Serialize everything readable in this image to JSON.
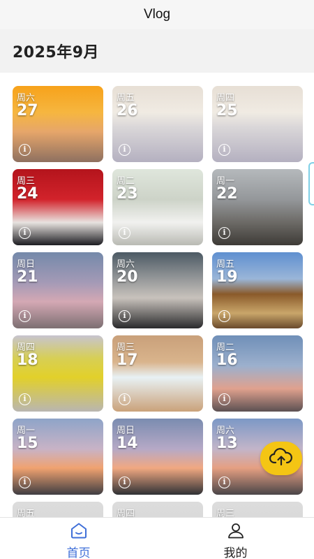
{
  "header": {
    "title": "Vlog"
  },
  "month_label": "2025年9月",
  "cards": [
    {
      "weekday": "周六",
      "day": "27",
      "bg": "sunset-sea"
    },
    {
      "weekday": "周五",
      "day": "26",
      "bg": "screen"
    },
    {
      "weekday": "周四",
      "day": "25",
      "bg": "screen"
    },
    {
      "weekday": "周三",
      "day": "24",
      "bg": "wedding"
    },
    {
      "weekday": "周二",
      "day": "23",
      "bg": "food"
    },
    {
      "weekday": "周一",
      "day": "22",
      "bg": "bus"
    },
    {
      "weekday": "周日",
      "day": "21",
      "bg": "sky-purple"
    },
    {
      "weekday": "周六",
      "day": "20",
      "bg": "metro"
    },
    {
      "weekday": "周五",
      "day": "19",
      "bg": "street"
    },
    {
      "weekday": "周四",
      "day": "18",
      "bg": "mango"
    },
    {
      "weekday": "周三",
      "day": "17",
      "bg": "snack"
    },
    {
      "weekday": "周二",
      "day": "16",
      "bg": "dusk-blue"
    },
    {
      "weekday": "周一",
      "day": "15",
      "bg": "dusk-road"
    },
    {
      "weekday": "周日",
      "day": "14",
      "bg": "dusk-tree"
    },
    {
      "weekday": "周六",
      "day": "13",
      "bg": "dusk-city"
    },
    {
      "weekday": "周五",
      "day": "",
      "bg": "grey"
    },
    {
      "weekday": "周四",
      "day": "",
      "bg": "grey"
    },
    {
      "weekday": "周三",
      "day": "",
      "bg": "grey"
    }
  ],
  "info_glyph": "i",
  "upload_button": {
    "icon": "cloud-upload-icon",
    "color": "#f4c514"
  },
  "tabbar": {
    "home_label": "首页",
    "home_icon": "home-icon",
    "mine_label": "我的",
    "mine_icon": "person-icon",
    "active_color": "#3f6fd8"
  }
}
